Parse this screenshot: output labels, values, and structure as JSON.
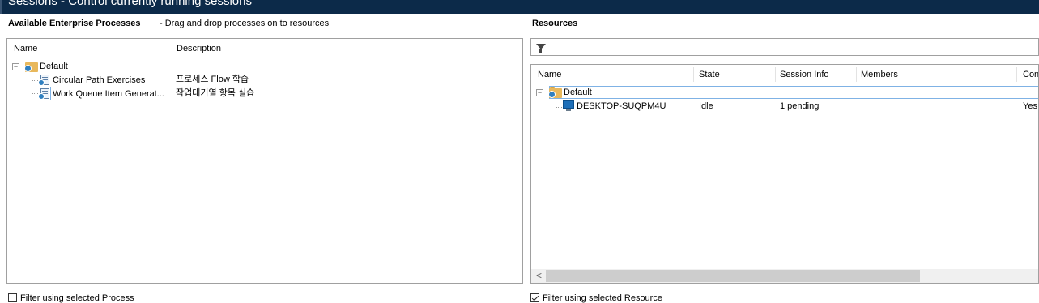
{
  "window": {
    "title": "Sessions - Control currently running sessions"
  },
  "left_panel": {
    "heading": "Available Enterprise Processes",
    "hint": "- Drag and drop processes on to resources",
    "columns": [
      "Name",
      "Description"
    ],
    "group": {
      "name": "Default",
      "expander": "−",
      "icon": "folder-icon"
    },
    "processes": [
      {
        "name": "Circular Path Exercises",
        "description": "프로세스 Flow 학습",
        "icon": "process-icon"
      },
      {
        "name": "Work Queue Item Generat...",
        "description": "작업대기열 항목 실습",
        "icon": "process-icon",
        "selected": true
      }
    ],
    "filter_checkbox": {
      "label": "Filter using selected Process",
      "checked": false
    }
  },
  "right_panel": {
    "heading": "Resources",
    "columns": [
      "Name",
      "State",
      "Session Info",
      "Members",
      "Con"
    ],
    "group": {
      "name": "Default",
      "expander": "−",
      "icon": "folder-icon"
    },
    "resources": [
      {
        "name": "DESKTOP-SUQPM4U",
        "state": "Idle",
        "session_info": "1 pending",
        "members": "",
        "connected": "Yes -",
        "icon": "computer-icon"
      }
    ],
    "scroll_left_arrow": "<",
    "filter_checkbox": {
      "label": "Filter using selected Resource",
      "checked": true
    }
  },
  "colors": {
    "titlebar": "#0c2a49",
    "selection_border": "#7fb2e5",
    "folder": "#e8b85c",
    "badge": "#2f7fc0"
  }
}
